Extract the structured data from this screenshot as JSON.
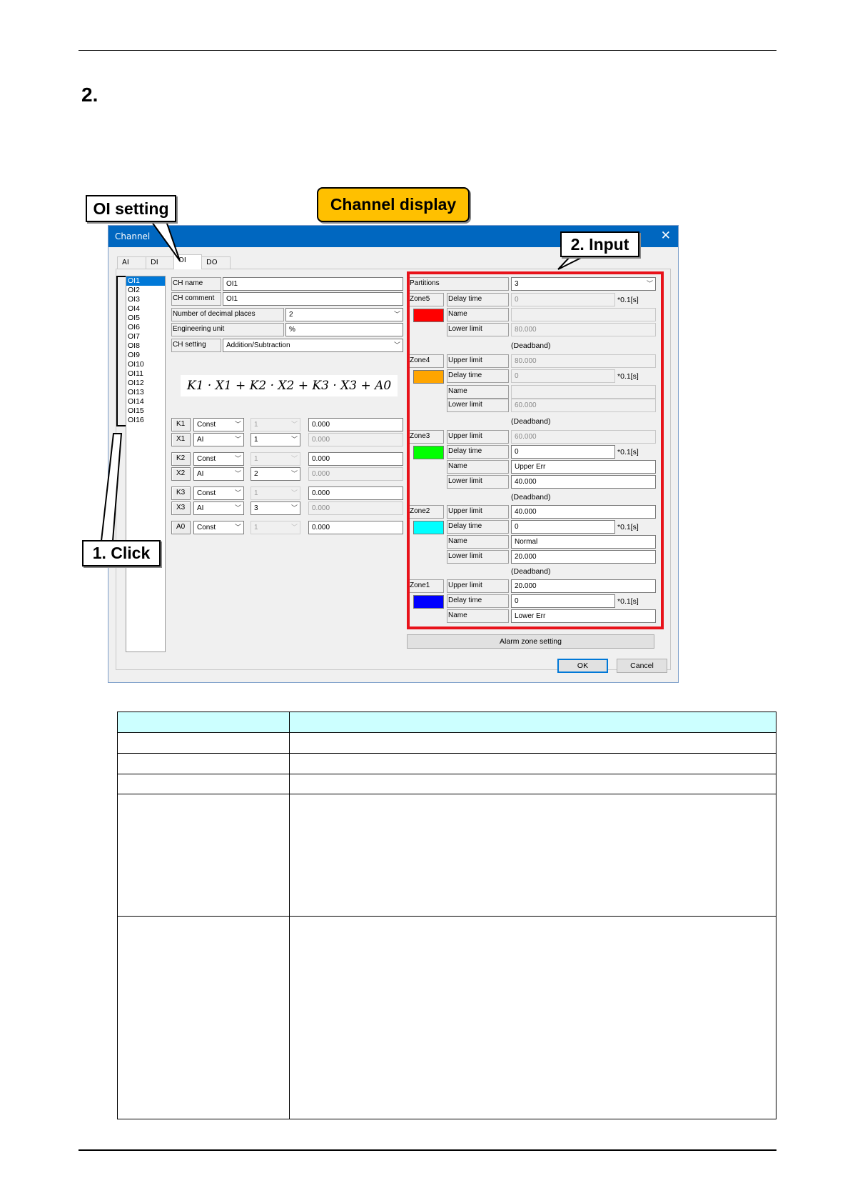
{
  "step": "2.",
  "callouts": {
    "oi_setting": "OI setting",
    "channel_display": "Channel display",
    "input": "2. Input",
    "click": "1. Click"
  },
  "dialog": {
    "title": "Channel",
    "close": "✕",
    "tabs": [
      "AI",
      "DI",
      "OI",
      "DO"
    ],
    "channels": [
      "OI1",
      "OI2",
      "OI3",
      "OI4",
      "OI5",
      "OI6",
      "OI7",
      "OI8",
      "OI9",
      "OI10",
      "OI11",
      "OI12",
      "OI13",
      "OI14",
      "OI15",
      "OI16"
    ],
    "ch_name": {
      "label": "CH name",
      "value": "OI1"
    },
    "ch_comment": {
      "label": "CH comment",
      "value": "OI1"
    },
    "decimal": {
      "label": "Number of decimal places",
      "value": "2"
    },
    "unit": {
      "label": "Engineering unit",
      "value": "%"
    },
    "ch_setting": {
      "label": "CH setting",
      "value": "Addition/Subtraction"
    },
    "formula": "K1 · X1 + K2 · X2 + K3 · X3 + A0",
    "terms": [
      {
        "label": "K1",
        "type": "Const",
        "num": "1",
        "value": "0.000"
      },
      {
        "label": "X1",
        "type": "AI",
        "num": "1",
        "value": "0.000"
      },
      {
        "label": "K2",
        "type": "Const",
        "num": "1",
        "value": "0.000"
      },
      {
        "label": "X2",
        "type": "AI",
        "num": "2",
        "value": "0.000"
      },
      {
        "label": "K3",
        "type": "Const",
        "num": "1",
        "value": "0.000"
      },
      {
        "label": "X3",
        "type": "AI",
        "num": "3",
        "value": "0.000"
      },
      {
        "label": "A0",
        "type": "Const",
        "num": "1",
        "value": "0.000"
      }
    ],
    "partitions": {
      "label": "Partitions",
      "value": "3"
    },
    "labels": {
      "delay": "Delay time",
      "name": "Name",
      "lower": "Lower limit",
      "upper": "Upper limit",
      "suffix": "*0.1[s]",
      "deadband": "(Deadband)"
    },
    "zones": {
      "zone5": {
        "label": "Zone5",
        "color": "#ff0000",
        "delay": "0",
        "name": "",
        "lower": "80.000"
      },
      "zone4": {
        "label": "Zone4",
        "color": "#ffa500",
        "upper": "80.000",
        "delay": "0",
        "name": "",
        "lower": "60.000"
      },
      "zone3": {
        "label": "Zone3",
        "color": "#00ff00",
        "upper": "60.000",
        "delay": "0",
        "name": "Upper Err",
        "lower": "40.000"
      },
      "zone2": {
        "label": "Zone2",
        "color": "#00ffff",
        "upper": "40.000",
        "delay": "0",
        "name": "Normal",
        "lower": "20.000"
      },
      "zone1": {
        "label": "Zone1",
        "color": "#0000ff",
        "upper": "20.000",
        "delay": "0",
        "name": "Lower Err"
      }
    },
    "alarm_button": "Alarm zone setting",
    "ok": "OK",
    "cancel": "Cancel"
  }
}
